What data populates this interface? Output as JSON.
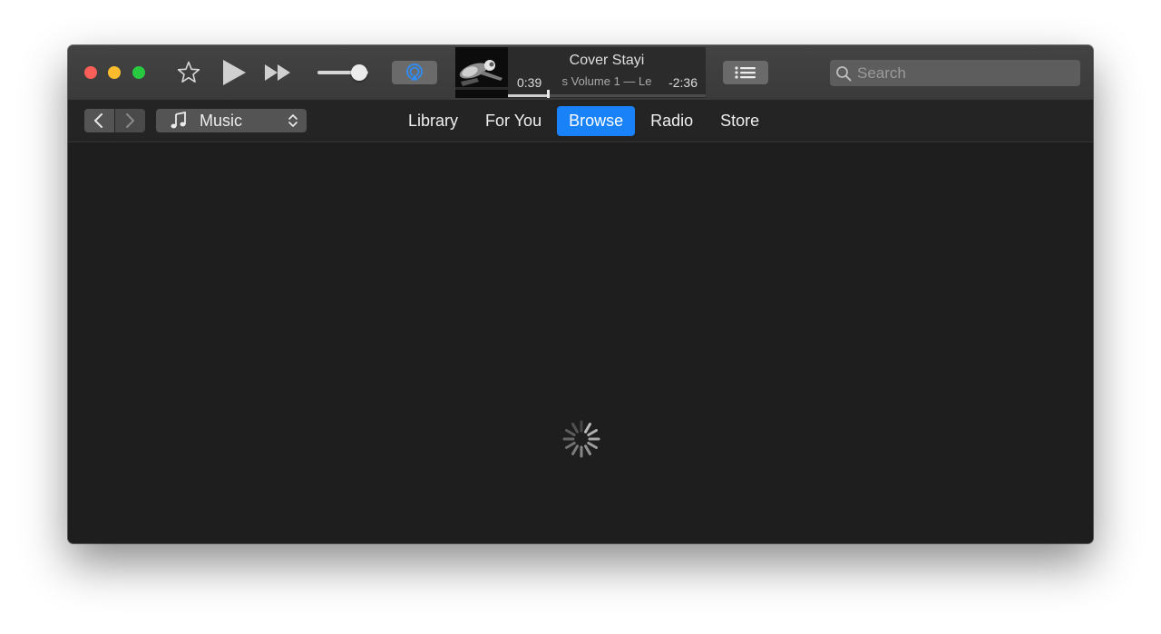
{
  "now_playing": {
    "title": "Cover   Stayi",
    "subtitle": "s Volume 1 — Le",
    "elapsed": "0:39",
    "remaining": "-2:36",
    "progress": 0.2
  },
  "volume": {
    "level": 0.83
  },
  "search": {
    "placeholder": "Search"
  },
  "media_picker": {
    "label": "Music"
  },
  "tabs": [
    {
      "label": "Library",
      "active": false
    },
    {
      "label": "For You",
      "active": false
    },
    {
      "label": "Browse",
      "active": true
    },
    {
      "label": "Radio",
      "active": false
    },
    {
      "label": "Store",
      "active": false
    }
  ],
  "colors": {
    "accent": "#1a82f9",
    "close": "#fc5f57",
    "minimize": "#fdbc2e",
    "maximize": "#28c840",
    "airplay": "#2e8df7"
  },
  "icons": {
    "favorite": "star-icon",
    "play": "play-icon",
    "forward": "fast-forward-icon",
    "airplay": "airplay-icon",
    "up_next": "list-icon",
    "search": "search-icon",
    "back": "chevron-left-icon",
    "forward_nav": "chevron-right-icon",
    "media": "music-note-icon",
    "picker": "updown-chevron-icon",
    "loading": "spinner-icon"
  }
}
